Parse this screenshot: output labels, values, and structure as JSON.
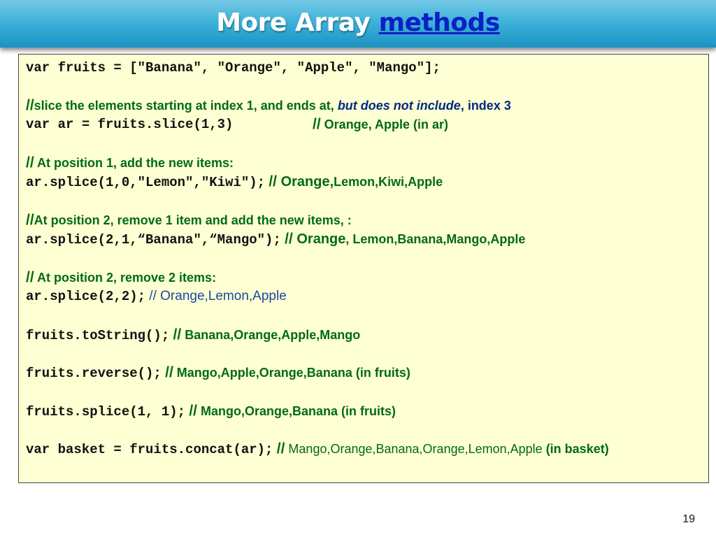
{
  "title": {
    "text": "More Array",
    "link": "methods"
  },
  "lines": {
    "l0": {
      "code": "var fruits = [\"Banana\", \"Orange\", \"Apple\", \"Mango\"];"
    },
    "l1": {
      "c1": "//",
      "c2": "slice the elements starting at index 1, and ends at, ",
      "c3": "but does not include",
      "c4": ", index 3"
    },
    "l2": {
      "code": "var ar = fruits.slice(1,3)",
      "c1": "//",
      "c2": " Orange, Apple  (in ar)"
    },
    "l3": {
      "c1": "//",
      "c2": " At position 1, add the new items:"
    },
    "l4": {
      "code": "ar.splice(1,0,\"Lemon\",\"Kiwi\");",
      "c1": "//",
      "c2": " Orange,",
      "c3": "Lemon,Kiwi,Apple"
    },
    "l5": {
      "c1": "//",
      "c2": "At position 2, remove 1 item and add the new items, :"
    },
    "l6": {
      "code": "ar.splice(2,1,“Banana\",“Mango\");",
      "c1": "//",
      "c2": " Orange",
      "c3": ", Lemon,Banana,Mango,Apple"
    },
    "l7": {
      "c1": "//",
      "c2": " At position 2, remove 2 items:"
    },
    "l8": {
      "code": "ar.splice(2,2);",
      "c1": " // Orange,Lemon,Apple"
    },
    "l9": {
      "code": "fruits.toString();",
      "c1": "//",
      "c2": " Banana,Orange,Apple,Mango"
    },
    "l10": {
      "code": "fruits.reverse();",
      "c1": "//",
      "c2": " Mango,Apple,Orange,Banana (in fruits)"
    },
    "l11": {
      "code": "fruits.splice(1, 1);",
      "c1": "//",
      "c2": " Mango,Orange,Banana (in fruits)"
    },
    "l12": {
      "code": "var basket = fruits.concat(ar);",
      "c1": "//",
      "c2": " Mango,Orange,Banana,Orange,Lemon,Apple",
      "c3": " (in basket)"
    }
  },
  "page_number": "19"
}
